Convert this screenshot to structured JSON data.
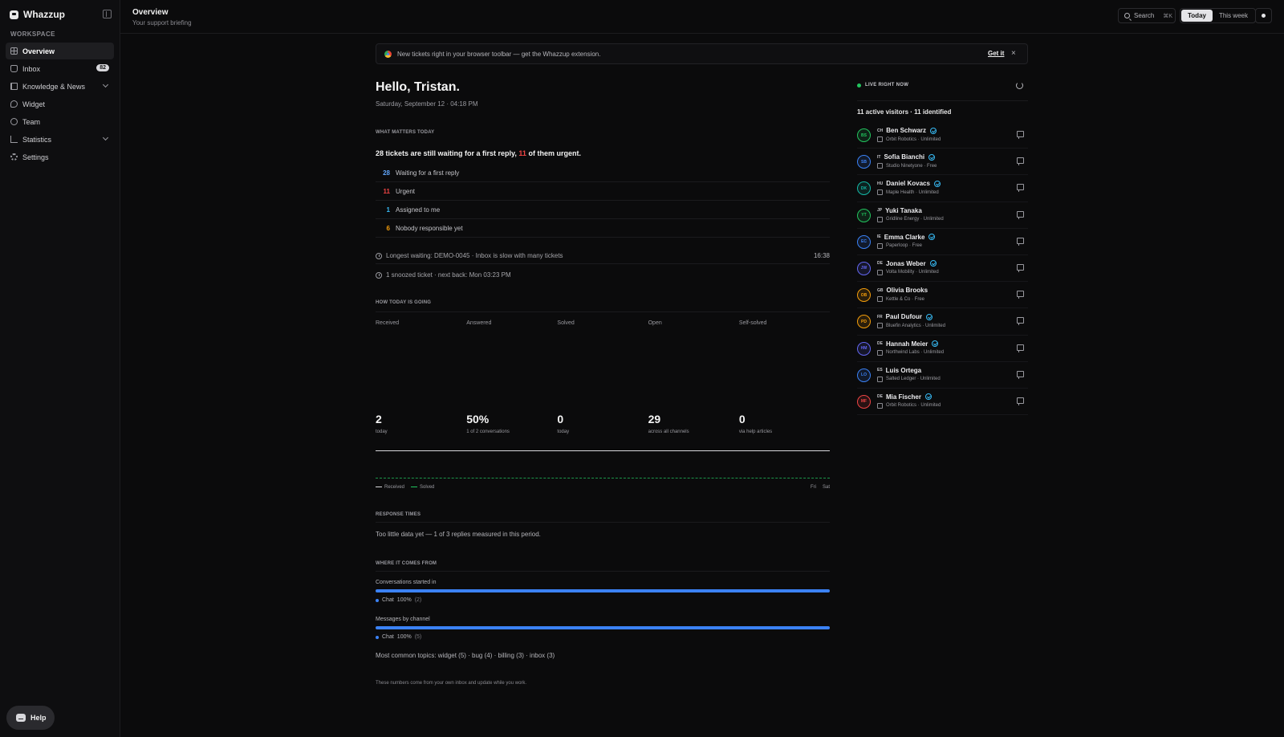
{
  "app": {
    "name": "Whazzup",
    "section_label": "WORKSPACE"
  },
  "sidebar": {
    "items": [
      {
        "label": "Overview",
        "icon": "grid-icon",
        "active": true
      },
      {
        "label": "Inbox",
        "icon": "inbox-icon",
        "badge": "82"
      },
      {
        "label": "Knowledge & News",
        "icon": "book-icon",
        "expandable": true
      },
      {
        "label": "Widget",
        "icon": "widget-icon"
      },
      {
        "label": "Team",
        "icon": "team-icon"
      },
      {
        "label": "Statistics",
        "icon": "stats-icon",
        "expandable": true
      },
      {
        "label": "Settings",
        "icon": "gear-icon"
      }
    ],
    "help_label": "Help"
  },
  "topbar": {
    "title": "Overview",
    "subtitle": "Your support briefing",
    "search_label": "Search",
    "search_shortcut": "⌘K",
    "range_options": [
      "Today",
      "This week"
    ],
    "range_selected": "Today"
  },
  "banner": {
    "text": "New tickets right in your browser toolbar — get the Whazzup extension.",
    "cta": "Get it",
    "close": "×"
  },
  "main": {
    "greeting": "Hello, Tristan.",
    "date": "Saturday, September 12 · 04:18 PM",
    "what_matters_label": "WHAT MATTERS TODAY",
    "summary_pre": "28 tickets are still waiting for a first reply,",
    "summary_urgent": "11",
    "summary_post": "of them urgent.",
    "metrics": [
      {
        "value": "28",
        "label": "Waiting for a first reply",
        "color": "#60a5fa"
      },
      {
        "value": "11",
        "label": "Urgent",
        "color": "#ef4444"
      },
      {
        "value": "1",
        "label": "Assigned to me",
        "color": "#38bdf8"
      },
      {
        "value": "6",
        "label": "Nobody responsible yet",
        "color": "#f59e0b"
      }
    ],
    "longest_waiting": "Longest waiting: DEMO-0045 · Inbox is slow with many tickets",
    "longest_waiting_time": "16:38",
    "snoozed": "1 snoozed ticket · next back: Mon 03:23 PM",
    "how_today_label": "HOW TODAY IS GOING",
    "stats": [
      {
        "header": "Received",
        "value": "2",
        "sub": "today"
      },
      {
        "header": "Answered",
        "value": "50%",
        "sub": "1 of 2 conversations"
      },
      {
        "header": "Solved",
        "value": "0",
        "sub": "today"
      },
      {
        "header": "Open",
        "value": "29",
        "sub": "across all channels"
      },
      {
        "header": "Self-solved",
        "value": "0",
        "sub": "via help articles"
      }
    ],
    "chart_legend": [
      {
        "name": "Received",
        "color": "#d8d8dc"
      },
      {
        "name": "Solved",
        "color": "#22c55e"
      }
    ],
    "chart_ticks": [
      "Fri",
      "Sat"
    ],
    "response_label": "RESPONSE TIMES",
    "response_text": "Too little data yet — 1 of 3 replies measured in this period.",
    "where_label": "WHERE IT COMES FROM",
    "channel_bars": [
      {
        "title": "Conversations started in",
        "channel": "Chat",
        "percent_label": "100%",
        "count": "(2)",
        "fraction": 1.0
      },
      {
        "title": "Messages by channel",
        "channel": "Chat",
        "percent_label": "100%",
        "count": "(5)",
        "fraction": 1.0
      }
    ],
    "topics": "Most common topics: widget (5) · bug (4) · billing (3) · inbox (3)",
    "footnote": "These numbers come from your own inbox and update while you work."
  },
  "live": {
    "label": "LIVE RIGHT NOW",
    "count_text": "11 active visitors · 11 identified",
    "visitors": [
      {
        "initials": "BS",
        "country": "CH",
        "name": "Ben Schwarz",
        "verified": true,
        "company": "Orbit Robotics · Unlimited",
        "color": "#22c55e"
      },
      {
        "initials": "SB",
        "country": "IT",
        "name": "Sofia Bianchi",
        "verified": true,
        "company": "Studio Ninetyone · Free",
        "color": "#3b82f6"
      },
      {
        "initials": "DK",
        "country": "HU",
        "name": "Daniel Kovacs",
        "verified": true,
        "company": "Maple Health · Unlimited",
        "color": "#14b8a6"
      },
      {
        "initials": "YT",
        "country": "JP",
        "name": "Yuki Tanaka",
        "verified": false,
        "company": "Gridline Energy · Unlimited",
        "color": "#22c55e"
      },
      {
        "initials": "EC",
        "country": "IE",
        "name": "Emma Clarke",
        "verified": true,
        "company": "Paperloop · Free",
        "color": "#3b82f6"
      },
      {
        "initials": "JW",
        "country": "DE",
        "name": "Jonas Weber",
        "verified": true,
        "company": "Volta Mobility · Unlimited",
        "color": "#6366f1"
      },
      {
        "initials": "OB",
        "country": "GB",
        "name": "Olivia Brooks",
        "verified": false,
        "company": "Kettle & Co · Free",
        "color": "#f59e0b"
      },
      {
        "initials": "PD",
        "country": "FR",
        "name": "Paul Dufour",
        "verified": true,
        "company": "Bluefin Analytics · Unlimited",
        "color": "#f59e0b"
      },
      {
        "initials": "HM",
        "country": "DE",
        "name": "Hannah Meier",
        "verified": true,
        "company": "Northwind Labs · Unlimited",
        "color": "#6366f1"
      },
      {
        "initials": "LO",
        "country": "ES",
        "name": "Luis Ortega",
        "verified": false,
        "company": "Salted Ledger · Unlimited",
        "color": "#3b82f6"
      },
      {
        "initials": "MF",
        "country": "DE",
        "name": "Mia Fischer",
        "verified": true,
        "company": "Orbit Robotics · Unlimited",
        "color": "#ef4444"
      }
    ]
  }
}
